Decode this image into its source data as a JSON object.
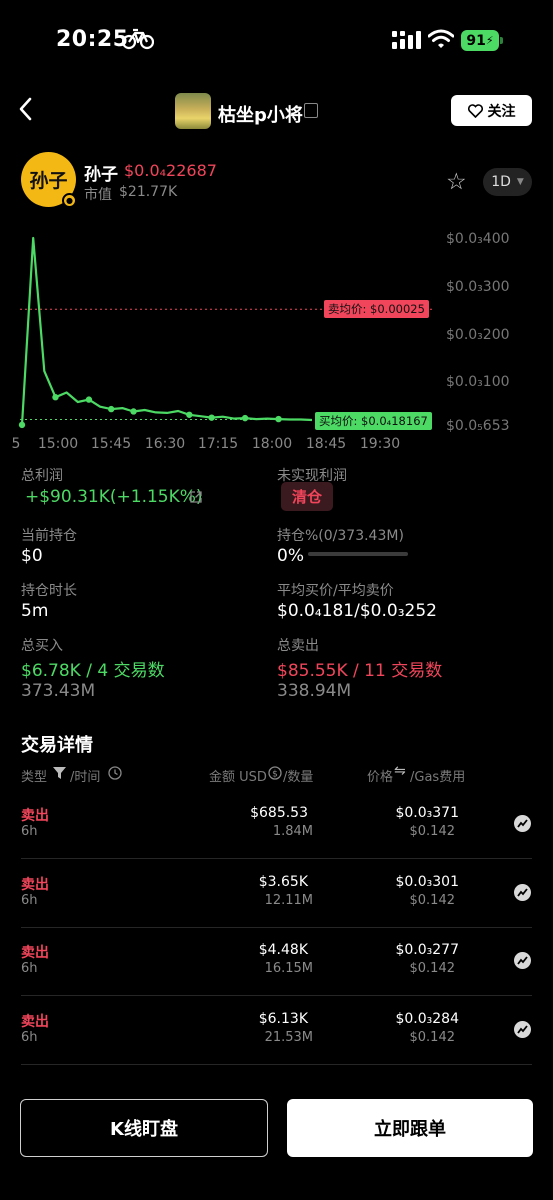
{
  "status_bar": {
    "time": "20:25",
    "battery": "91"
  },
  "header": {
    "title": "枯坐p小将",
    "follow_label": "关注"
  },
  "token": {
    "avatar_text": "孙子",
    "name": "孙子",
    "price": "$0.0₄22687",
    "market_cap_label": "市值",
    "market_cap": "$21.77K",
    "timeframe": "1D"
  },
  "chart_data": {
    "type": "line",
    "x_ticks": [
      "5",
      "15:00",
      "15:45",
      "16:30",
      "17:15",
      "18:00",
      "18:45",
      "19:30"
    ],
    "y_ticks": [
      "$0.0₃400",
      "$0.0₃300",
      "$0.0₃200",
      "$0.0₃100",
      "$0.0₅653"
    ],
    "series": [
      {
        "color": "#4cd964",
        "values_usd": [
          6.8e-06,
          0.0004,
          0.00012,
          6.5e-05,
          7.5e-05,
          5.5e-05,
          6e-05,
          4.5e-05,
          4e-05,
          4.2e-05,
          3.5e-05,
          3.8e-05,
          3.3e-05,
          3.2e-05,
          3.6e-05,
          2.8e-05,
          2.5e-05,
          2.2e-05,
          2.4e-05,
          2e-05,
          2.1e-05,
          1.9e-05,
          2e-05,
          1.9e-05,
          1.8e-05,
          1.8e-05,
          1.7e-05
        ]
      }
    ],
    "markers_usd": [
      6.8e-06,
      6.5e-05,
      4.5e-05,
      4e-05,
      3.8e-05,
      2.5e-05,
      2.2e-05,
      2.1e-05,
      1.9e-05
    ],
    "annotations": {
      "sell_avg": "卖均价: $0.00025",
      "buy_avg": "买均价: $0.0₄18167"
    },
    "sell_avg_usd": 0.00025,
    "buy_avg_usd": 1.8167e-05,
    "ylim_usd": [
      6.53e-06,
      0.0004
    ],
    "grid": false
  },
  "stats": {
    "total_profit_label": "总利润",
    "total_profit": "+$90.31K(+1.15K%)",
    "unrealized_label": "未实现利润",
    "clear_label": "清仓",
    "holding_label": "当前持仓",
    "holding": "$0",
    "holding_pct_label": "持仓%(0/373.43M)",
    "holding_pct": "0%",
    "holding_pct_fraction": 0,
    "duration_label": "持仓时长",
    "duration": "5m",
    "avg_price_label": "平均买价/平均卖价",
    "avg_price": "$0.0₄181/$0.0₃252",
    "total_buy_label": "总买入",
    "total_buy": "$6.78K / 4 交易数",
    "total_buy_qty": "373.43M",
    "total_sell_label": "总卖出",
    "total_sell": "$85.55K / 11 交易数",
    "total_sell_qty": "338.94M"
  },
  "trades": {
    "title": "交易详情",
    "col_type": "类型",
    "col_time": "/时间",
    "col_amount": "金额 USD",
    "col_qty": "/数量",
    "col_price": "价格",
    "col_gas": "/Gas费用",
    "rows": [
      {
        "type": "卖出",
        "time": "6h",
        "amount": "$685.53",
        "qty": "1.84M",
        "price": "$0.0₃371",
        "gas": "$0.142"
      },
      {
        "type": "卖出",
        "time": "6h",
        "amount": "$3.65K",
        "qty": "12.11M",
        "price": "$0.0₃301",
        "gas": "$0.142"
      },
      {
        "type": "卖出",
        "time": "6h",
        "amount": "$4.48K",
        "qty": "16.15M",
        "price": "$0.0₃277",
        "gas": "$0.142"
      },
      {
        "type": "卖出",
        "time": "6h",
        "amount": "$6.13K",
        "qty": "21.53M",
        "price": "$0.0₃284",
        "gas": "$0.142"
      }
    ]
  },
  "footer": {
    "kline_label": "K线盯盘",
    "copy_label": "立即跟单"
  },
  "colors": {
    "up": "#4cd964",
    "down": "#f0455a",
    "background": "#000000"
  }
}
